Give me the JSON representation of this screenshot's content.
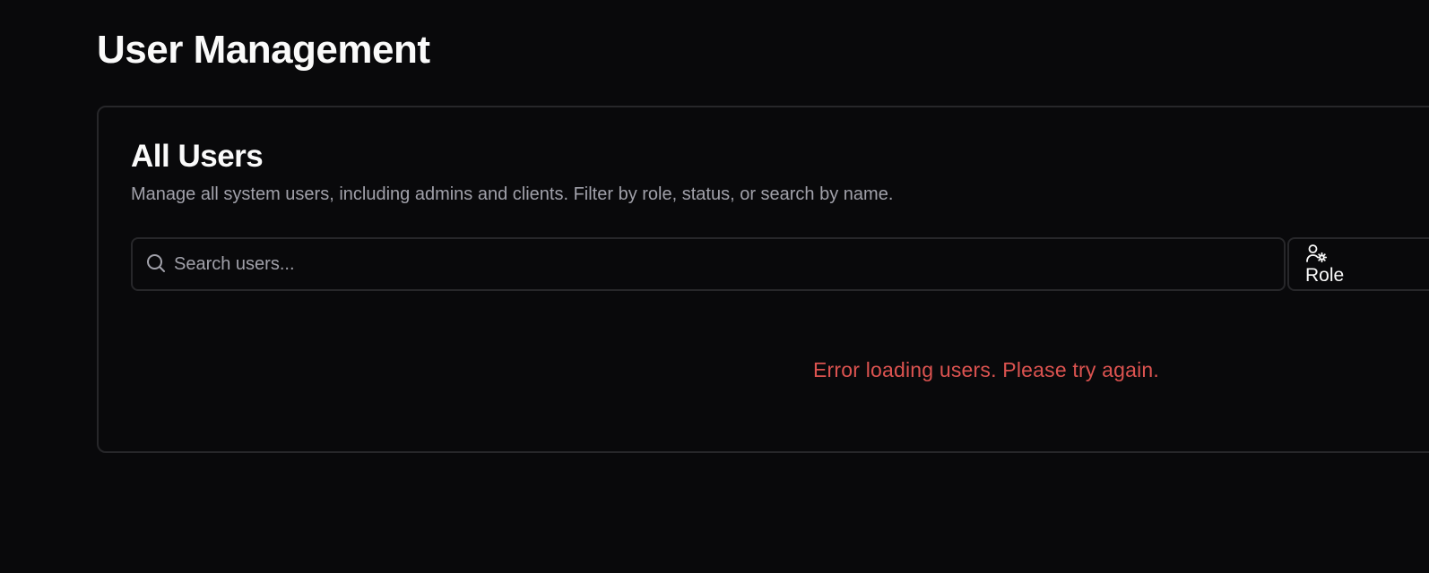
{
  "page": {
    "title": "User Management"
  },
  "card": {
    "title": "All Users",
    "description": "Manage all system users, including admins and clients. Filter by role, status, or search by name."
  },
  "search": {
    "placeholder": "Search users...",
    "value": "",
    "icon": "search-icon"
  },
  "filters": {
    "role_label": "Role",
    "role_icon": "user-cog-icon"
  },
  "status": {
    "error": "Error loading users. Please try again."
  },
  "colors": {
    "background": "#09090b",
    "border": "#27272a",
    "text": "#fafafa",
    "muted_text": "#a1a1aa",
    "error": "#dc5350"
  }
}
